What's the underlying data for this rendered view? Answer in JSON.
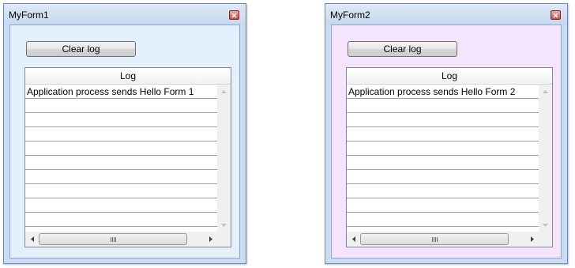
{
  "windows": [
    {
      "title": "MyForm1",
      "clear_button": "Clear log",
      "log_header": "Log",
      "log_entries": [
        "Application process sends Hello Form 1",
        "",
        "",
        "",
        "",
        "",
        "",
        "",
        "",
        ""
      ],
      "client_color": "#e4f0fe"
    },
    {
      "title": "MyForm2",
      "clear_button": "Clear log",
      "log_header": "Log",
      "log_entries": [
        "Application process sends Hello Form 2",
        "",
        "",
        "",
        "",
        "",
        "",
        "",
        "",
        ""
      ],
      "client_color": "#f4e4fe"
    }
  ],
  "icons": {
    "close": "close-icon",
    "scroll_up": "arrow-up-icon",
    "scroll_down": "arrow-down-icon",
    "scroll_left": "arrow-left-icon",
    "scroll_right": "arrow-right-icon",
    "grip": "grip-icon"
  }
}
